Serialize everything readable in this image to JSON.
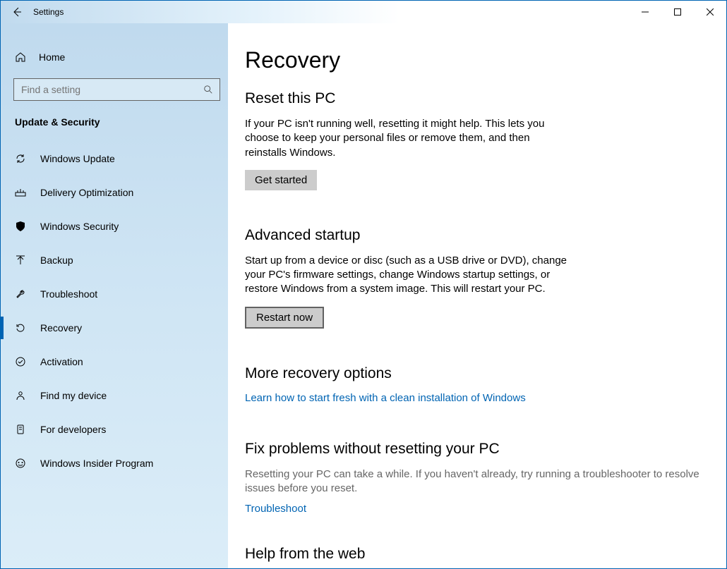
{
  "window": {
    "title": "Settings"
  },
  "sidebar": {
    "home_label": "Home",
    "search_placeholder": "Find a setting",
    "category": "Update & Security",
    "items": [
      {
        "icon": "sync-icon",
        "label": "Windows Update"
      },
      {
        "icon": "delivery-icon",
        "label": "Delivery Optimization"
      },
      {
        "icon": "shield-icon",
        "label": "Windows Security"
      },
      {
        "icon": "backup-icon",
        "label": "Backup"
      },
      {
        "icon": "wrench-icon",
        "label": "Troubleshoot"
      },
      {
        "icon": "recovery-icon",
        "label": "Recovery"
      },
      {
        "icon": "activation-icon",
        "label": "Activation"
      },
      {
        "icon": "findmy-icon",
        "label": "Find my device"
      },
      {
        "icon": "devs-icon",
        "label": "For developers"
      },
      {
        "icon": "insider-icon",
        "label": "Windows Insider Program"
      }
    ]
  },
  "main": {
    "title": "Recovery",
    "reset": {
      "heading": "Reset this PC",
      "body": "If your PC isn't running well, resetting it might help. This lets you choose to keep your personal files or remove them, and then reinstalls Windows.",
      "button": "Get started"
    },
    "advanced": {
      "heading": "Advanced startup",
      "body": "Start up from a device or disc (such as a USB drive or DVD), change your PC's firmware settings, change Windows startup settings, or restore Windows from a system image. This will restart your PC.",
      "button": "Restart now"
    },
    "more": {
      "heading": "More recovery options",
      "link": "Learn how to start fresh with a clean installation of Windows"
    },
    "fix": {
      "heading": "Fix problems without resetting your PC",
      "body": "Resetting your PC can take a while. If you haven't already, try running a troubleshooter to resolve issues before you reset.",
      "link": "Troubleshoot"
    },
    "help": {
      "heading": "Help from the web"
    }
  }
}
